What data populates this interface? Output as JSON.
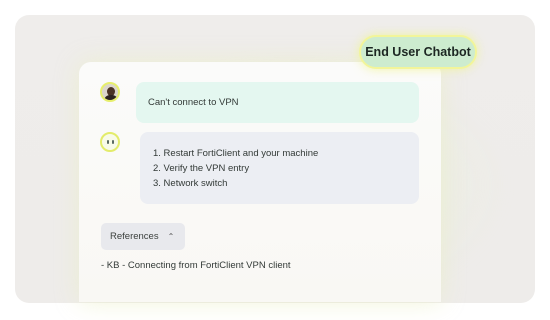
{
  "badge": {
    "label": "End User Chatbot"
  },
  "conversation": {
    "user_message": "Can't connect to VPN",
    "bot_steps": [
      "1. Restart FortiClient and your machine",
      "2. Verify the VPN entry",
      "3. Network switch"
    ]
  },
  "references": {
    "toggle_label": "References",
    "toggle_icon": "chevron-up-icon",
    "items": [
      "- KB - Connecting from FortiClient VPN client"
    ]
  },
  "colors": {
    "badge_fill": "#cdeccf",
    "badge_border": "#f2f59a",
    "user_bubble": "#e4f7f0",
    "bot_bubble": "#eceef3",
    "avatar_ring": "#e7ef6d"
  }
}
